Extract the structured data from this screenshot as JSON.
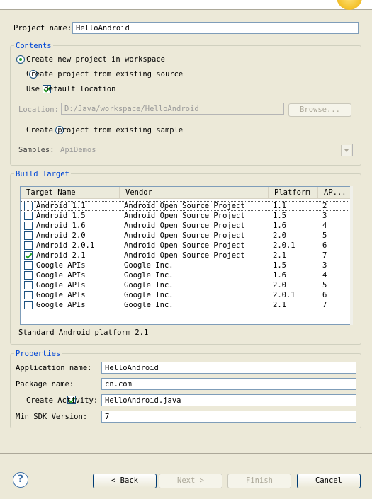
{
  "project_name": {
    "label": "Project name:",
    "value": "HelloAndroid"
  },
  "contents": {
    "legend": "Contents",
    "options": [
      {
        "label": "Create new project in workspace",
        "selected": true
      },
      {
        "label": "Create project from existing source",
        "selected": false
      }
    ],
    "use_default_location": {
      "label": "Use default location",
      "checked": true
    },
    "location": {
      "label": "Location:",
      "value": "D:/Java/workspace/HelloAndroid",
      "browse_label": "Browse..."
    },
    "sample_option": {
      "label": "Create project from existing sample",
      "selected": false
    },
    "samples": {
      "label": "Samples:",
      "value": "ApiDemos"
    }
  },
  "build_target": {
    "legend": "Build Target",
    "columns": [
      "Target Name",
      "Vendor",
      "Platform",
      "AP..."
    ],
    "rows": [
      {
        "name": "Android 1.1",
        "vendor": "Android Open Source Project",
        "platform": "1.1",
        "api": "2",
        "checked": false
      },
      {
        "name": "Android 1.5",
        "vendor": "Android Open Source Project",
        "platform": "1.5",
        "api": "3",
        "checked": false
      },
      {
        "name": "Android 1.6",
        "vendor": "Android Open Source Project",
        "platform": "1.6",
        "api": "4",
        "checked": false
      },
      {
        "name": "Android 2.0",
        "vendor": "Android Open Source Project",
        "platform": "2.0",
        "api": "5",
        "checked": false
      },
      {
        "name": "Android 2.0.1",
        "vendor": "Android Open Source Project",
        "platform": "2.0.1",
        "api": "6",
        "checked": false
      },
      {
        "name": "Android 2.1",
        "vendor": "Android Open Source Project",
        "platform": "2.1",
        "api": "7",
        "checked": true
      },
      {
        "name": "Google APIs",
        "vendor": "Google Inc.",
        "platform": "1.5",
        "api": "3",
        "checked": false
      },
      {
        "name": "Google APIs",
        "vendor": "Google Inc.",
        "platform": "1.6",
        "api": "4",
        "checked": false
      },
      {
        "name": "Google APIs",
        "vendor": "Google Inc.",
        "platform": "2.0",
        "api": "5",
        "checked": false
      },
      {
        "name": "Google APIs",
        "vendor": "Google Inc.",
        "platform": "2.0.1",
        "api": "6",
        "checked": false
      },
      {
        "name": "Google APIs",
        "vendor": "Google Inc.",
        "platform": "2.1",
        "api": "7",
        "checked": false
      }
    ],
    "description": "Standard Android platform 2.1"
  },
  "properties": {
    "legend": "Properties",
    "application_name": {
      "label": "Application name:",
      "value": "HelloAndroid"
    },
    "package_name": {
      "label": "Package name:",
      "value": "cn.com"
    },
    "create_activity": {
      "label": "Create Activity:",
      "value": "HelloAndroid.java",
      "checked": true
    },
    "min_sdk": {
      "label": "Min SDK Version:",
      "value": "7"
    }
  },
  "buttons": {
    "help": "?",
    "back": "< Back",
    "next": "Next >",
    "finish": "Finish",
    "cancel": "Cancel"
  },
  "icons": {
    "help": "help-icon",
    "banner": "sun-icon"
  }
}
